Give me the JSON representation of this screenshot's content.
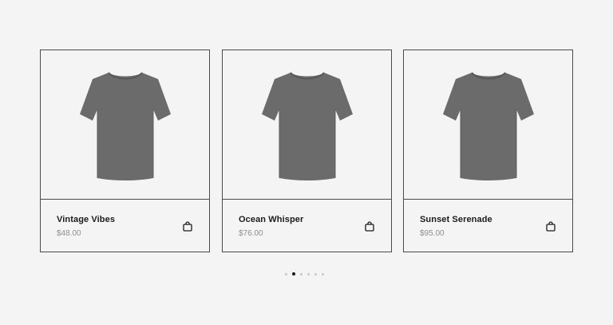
{
  "products": [
    {
      "name": "Vintage Vibes",
      "price": "$48.00",
      "icon": "shopping-bag-icon",
      "image": "gray-tshirt"
    },
    {
      "name": "Ocean Whisper",
      "price": "$76.00",
      "icon": "shopping-bag-icon",
      "image": "gray-tshirt"
    },
    {
      "name": "Sunset Serenade",
      "price": "$95.00",
      "icon": "shopping-bag-icon",
      "image": "gray-tshirt"
    }
  ],
  "pagination": {
    "total": 6,
    "active_index": 1
  },
  "colors": {
    "background": "#f4f4f4",
    "border": "#4a4a4a",
    "shirt": "#6b6b6b",
    "price": "#8f8f8f",
    "active_dot": "#1a1a1a",
    "inactive_dot": "#c8c8c8"
  }
}
